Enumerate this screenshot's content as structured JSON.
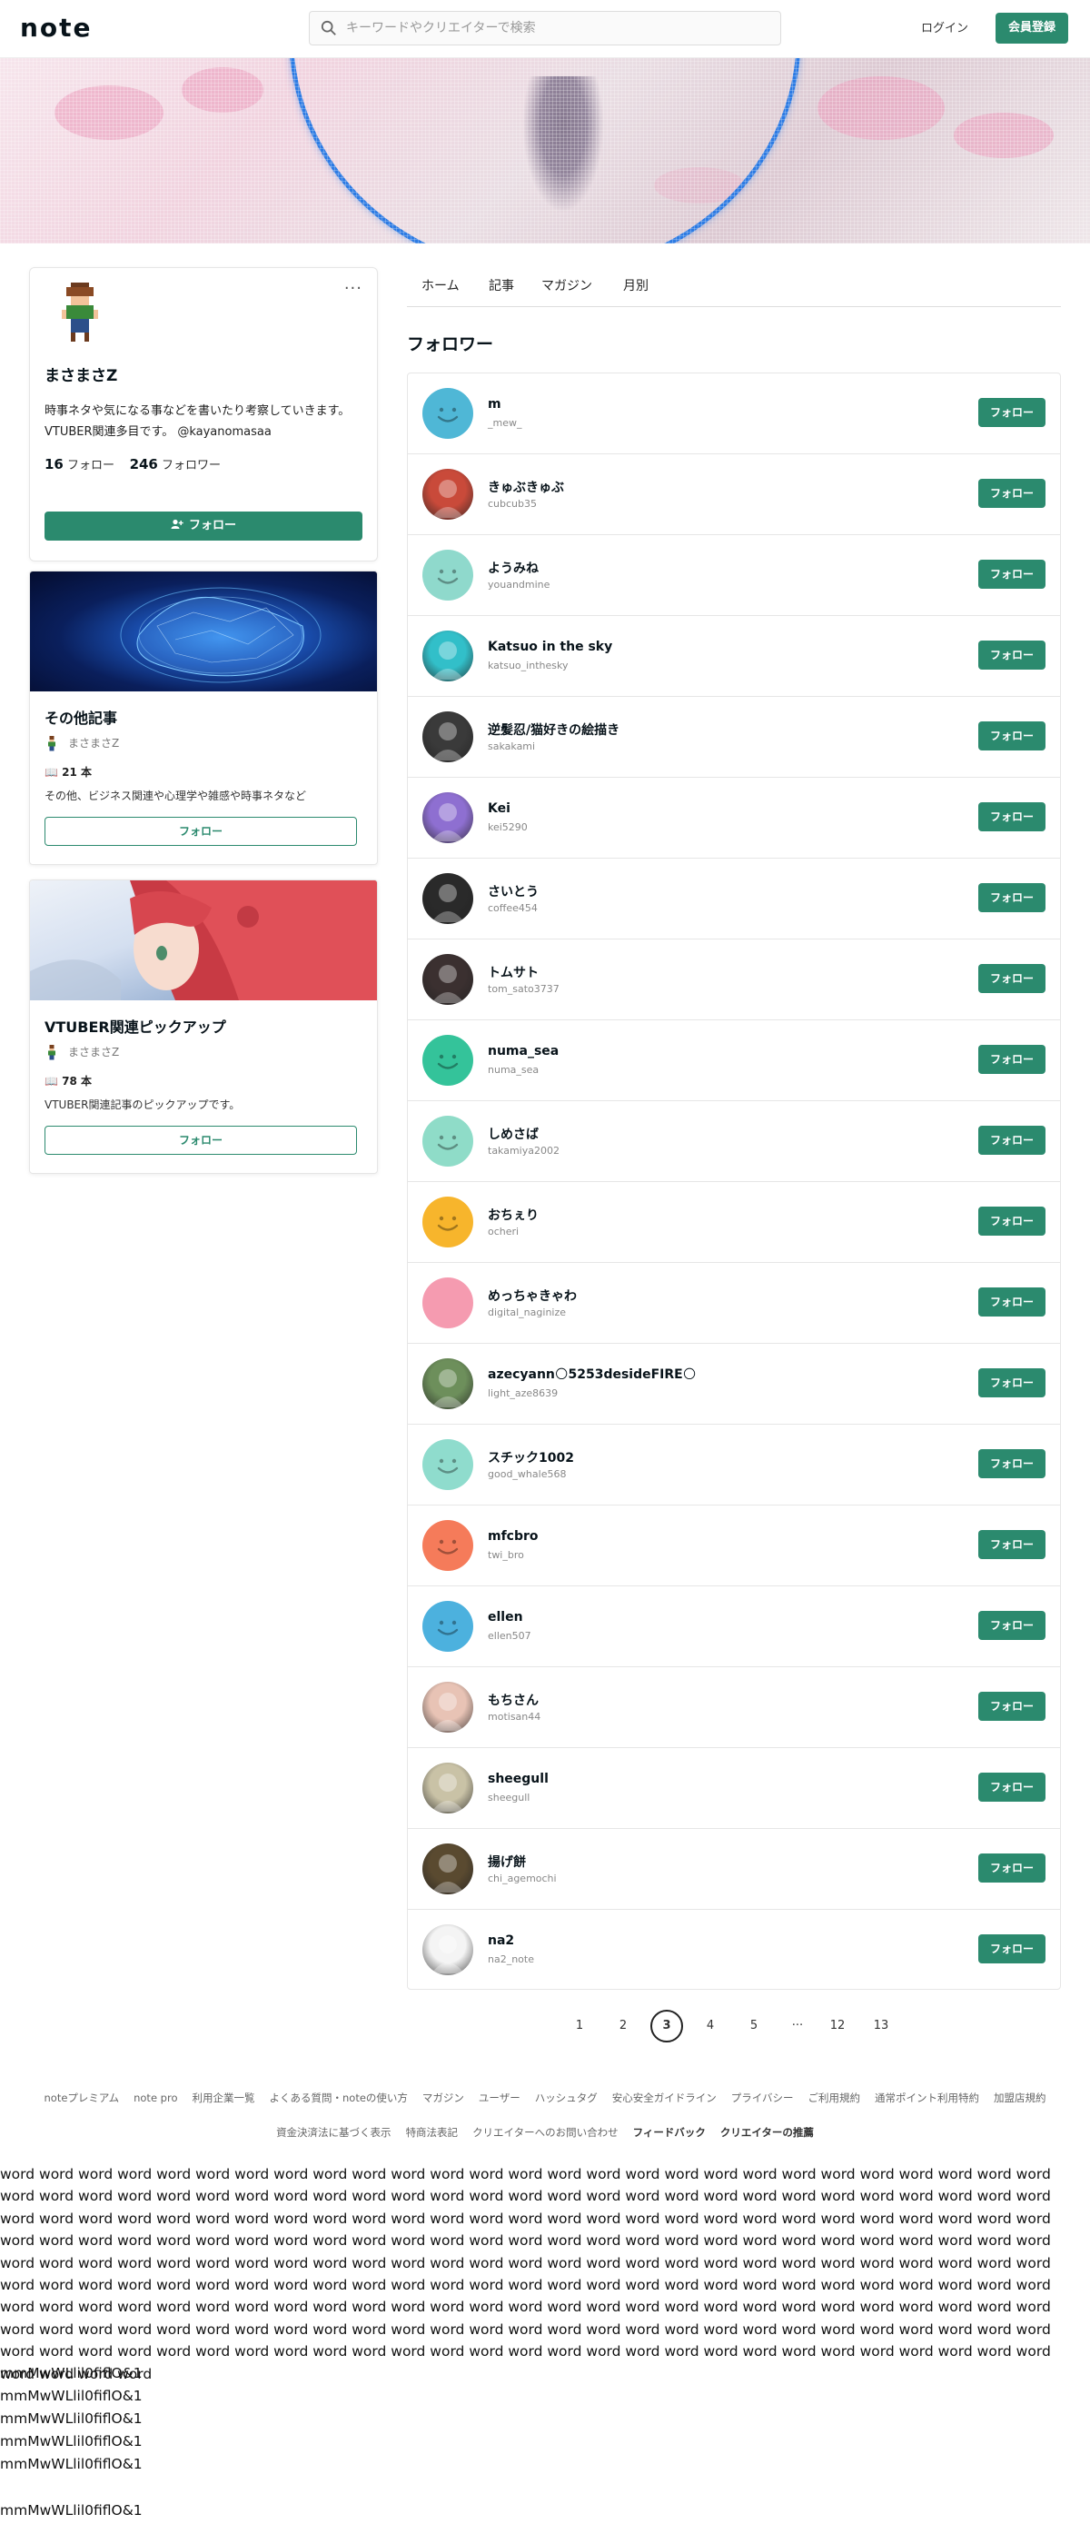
{
  "header": {
    "logo": "note",
    "search_placeholder": "キーワードやクリエイターで検索",
    "login": "ログイン",
    "signup": "会員登録"
  },
  "profile": {
    "name": "まさまさZ",
    "bio": "時事ネタや気になる事などを書いたり考察していきます。VTUBER関連多目です。 @kayanomasaa",
    "following_count": "16",
    "following_label": "フォロー",
    "followers_count": "246",
    "followers_label": "フォロワー",
    "follow_button": "フォロー",
    "more": "···"
  },
  "magazines": [
    {
      "title": "その他記事",
      "author": "まさまさZ",
      "count": "21 本",
      "description": "その他、ビジネス関連や心理学や雑感や時事ネタなど",
      "follow": "フォロー"
    },
    {
      "title": "VTUBER関連ピックアップ",
      "author": "まさまさZ",
      "count": "78 本",
      "description": "VTUBER関連記事のピックアップです。",
      "follow": "フォロー"
    }
  ],
  "tabs": [
    "ホーム",
    "記事",
    "マガジン",
    "月別"
  ],
  "section_title": "フォロワー",
  "followers": [
    {
      "name": "m",
      "id": "_mew_",
      "avatar": "smile-blue",
      "color": "#4fb7d6"
    },
    {
      "name": "きゅぶきゅぶ",
      "id": "cubcub35",
      "avatar": "photo-red",
      "color": "#c94a3a"
    },
    {
      "name": "ようみね",
      "id": "youandmine",
      "avatar": "smile-mint",
      "color": "#8fd9cc"
    },
    {
      "name": "Katsuo in the sky",
      "id": "katsuo_inthesky",
      "avatar": "photo-teal",
      "color": "#32bfc9"
    },
    {
      "name": "逆髪忍/猫好きの絵描き",
      "id": "sakakami",
      "avatar": "photo-bw",
      "color": "#3a3a3a"
    },
    {
      "name": "Kei",
      "id": "kei5290",
      "avatar": "photo-purple",
      "color": "#8e6fd1"
    },
    {
      "name": "さいとう",
      "id": "coffee454",
      "avatar": "photo-dark",
      "color": "#2a2a2a"
    },
    {
      "name": "トムサト",
      "id": "tom_sato3737",
      "avatar": "photo-dark2",
      "color": "#3b3030"
    },
    {
      "name": "numa_sea",
      "id": "numa_sea",
      "avatar": "smile-green",
      "color": "#34c39a"
    },
    {
      "name": "しめさば",
      "id": "takamiya2002",
      "avatar": "smile-mint2",
      "color": "#8fdcc8"
    },
    {
      "name": "おちぇり",
      "id": "ocheri",
      "avatar": "smile-yellow",
      "color": "#f7b52c"
    },
    {
      "name": "めっちゃきゃわ",
      "id": "digital_naginize",
      "avatar": "plain-pink",
      "color": "#f59bb0"
    },
    {
      "name": "azecyann🌕5253desideFIRE🌕",
      "id": "light_aze8639",
      "avatar": "photo-outdoor",
      "color": "#6d8f5b"
    },
    {
      "name": "スチック1002",
      "id": "good_whale568",
      "avatar": "smile-mint3",
      "color": "#8fdccd"
    },
    {
      "name": "mfcbro",
      "id": "twi_bro",
      "avatar": "smile-orange",
      "color": "#f57b5a"
    },
    {
      "name": "ellen",
      "id": "ellen507",
      "avatar": "smile-blue2",
      "color": "#4cb1de"
    },
    {
      "name": "もちさん",
      "id": "motisan44",
      "avatar": "photo-anime",
      "color": "#e8c3b5"
    },
    {
      "name": "sheegull",
      "id": "sheegull",
      "avatar": "photo-cat",
      "color": "#c9c2a6"
    },
    {
      "name": "揚げ餅",
      "id": "chi_agemochi",
      "avatar": "photo-pixel",
      "color": "#5a4a30"
    },
    {
      "name": "na2",
      "id": "na2_note",
      "avatar": "photo-sketch",
      "color": "#f4f4f4"
    }
  ],
  "follow_label": "フォロー",
  "pagination": [
    "1",
    "2",
    "3",
    "4",
    "5",
    "···",
    "12",
    "13"
  ],
  "pagination_current": "3",
  "footer_row1": [
    "noteプレミアム",
    "note pro",
    "利用企業一覧",
    "よくある質問・noteの使い方",
    "マガジン",
    "ユーザー",
    "ハッシュタグ",
    "安心安全ガイドライン",
    "プライバシー",
    "ご利用規約",
    "通常ポイント利用特約",
    "加盟店規約"
  ],
  "footer_row2": [
    "資金決済法に基づく表示",
    "特商法表記",
    "クリエイターへのお問い合わせ",
    "フィードバック",
    "クリエイターの推薦"
  ],
  "lorem": "word word word word word word word word word word word word word word word word word word word word word word word word word word word word word word word word word word word word word word word word word word word word word word word word word word word word word word word word word word word word word word word word word word word word word word word word word word word word word word word word word word word word word word word word word word word word word word word word word word word word word word word word word word word word word word word word word word word word word word word word word word word word word word word word word word word word word word word word word word word word word word word word word word word word word word word word word word word word word word word word word word word word word word word word word word word word word word word word word word word word word word word word word word word word word word word word word word word word word word word word word word word word word word word word word word word word word word word word word word word word word word word word word word word word word word word word word word word word word word word word word word word word word word word",
  "mm_lines": [
    "mmMwWLlil0fiflO&1",
    "mmMwWLlil0fiflO&1",
    "mmMwWLlil0fiflO&1",
    "mmMwWLlil0fiflO&1",
    "mmMwWLlil0fiflO&1",
    "mmMwWLlil0fiflO&1"
  ]
}
